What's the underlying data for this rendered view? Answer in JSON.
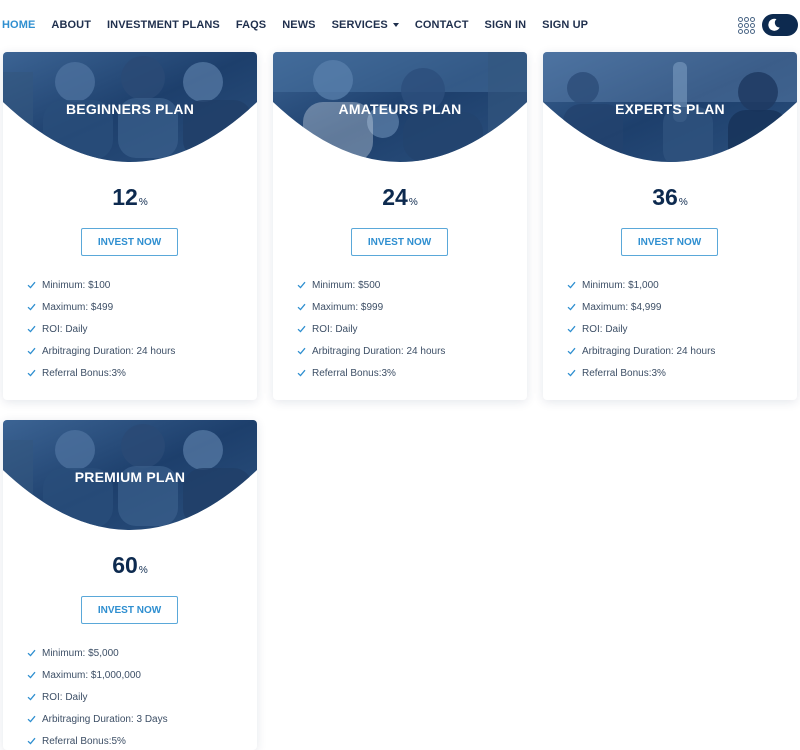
{
  "nav": {
    "items": [
      {
        "label": "HOME",
        "active": true
      },
      {
        "label": "ABOUT"
      },
      {
        "label": "INVESTMENT PLANS"
      },
      {
        "label": "FAQS"
      },
      {
        "label": "NEWS"
      },
      {
        "label": "SERVICES",
        "dropdown": true
      },
      {
        "label": "CONTACT"
      },
      {
        "label": "SIGN IN"
      },
      {
        "label": "SIGN UP"
      }
    ],
    "icons": [
      "apps-grid-icon",
      "moon-icon"
    ]
  },
  "colors": {
    "accent": "#2f8fd0",
    "navy": "#0d2a4f",
    "header_overlay": "#1b3f6e"
  },
  "plans": [
    {
      "title": "BEGINNERS PLAN",
      "rate": "12",
      "unit": "%",
      "button": "INVEST NOW",
      "features": [
        "Minimum: $100",
        "Maximum: $499",
        "ROI: Daily",
        "Arbitraging Duration: 24 hours",
        "Referral Bonus:3%"
      ]
    },
    {
      "title": "AMATEURS PLAN",
      "rate": "24",
      "unit": "%",
      "button": "INVEST NOW",
      "features": [
        "Minimum: $500",
        "Maximum: $999",
        "ROI: Daily",
        "Arbitraging Duration: 24 hours",
        "Referral Bonus:3%"
      ]
    },
    {
      "title": "EXPERTS PLAN",
      "rate": "36",
      "unit": "%",
      "button": "INVEST NOW",
      "features": [
        "Minimum: $1,000",
        "Maximum: $4,999",
        "ROI: Daily",
        "Arbitraging Duration: 24 hours",
        "Referral Bonus:3%"
      ]
    },
    {
      "title": "PREMIUM PLAN",
      "rate": "60",
      "unit": "%",
      "button": "INVEST NOW",
      "features": [
        "Minimum: $5,000",
        "Maximum: $1,000,000",
        "ROI: Daily",
        "Arbitraging Duration: 3 Days",
        "Referral Bonus:5%"
      ]
    }
  ]
}
